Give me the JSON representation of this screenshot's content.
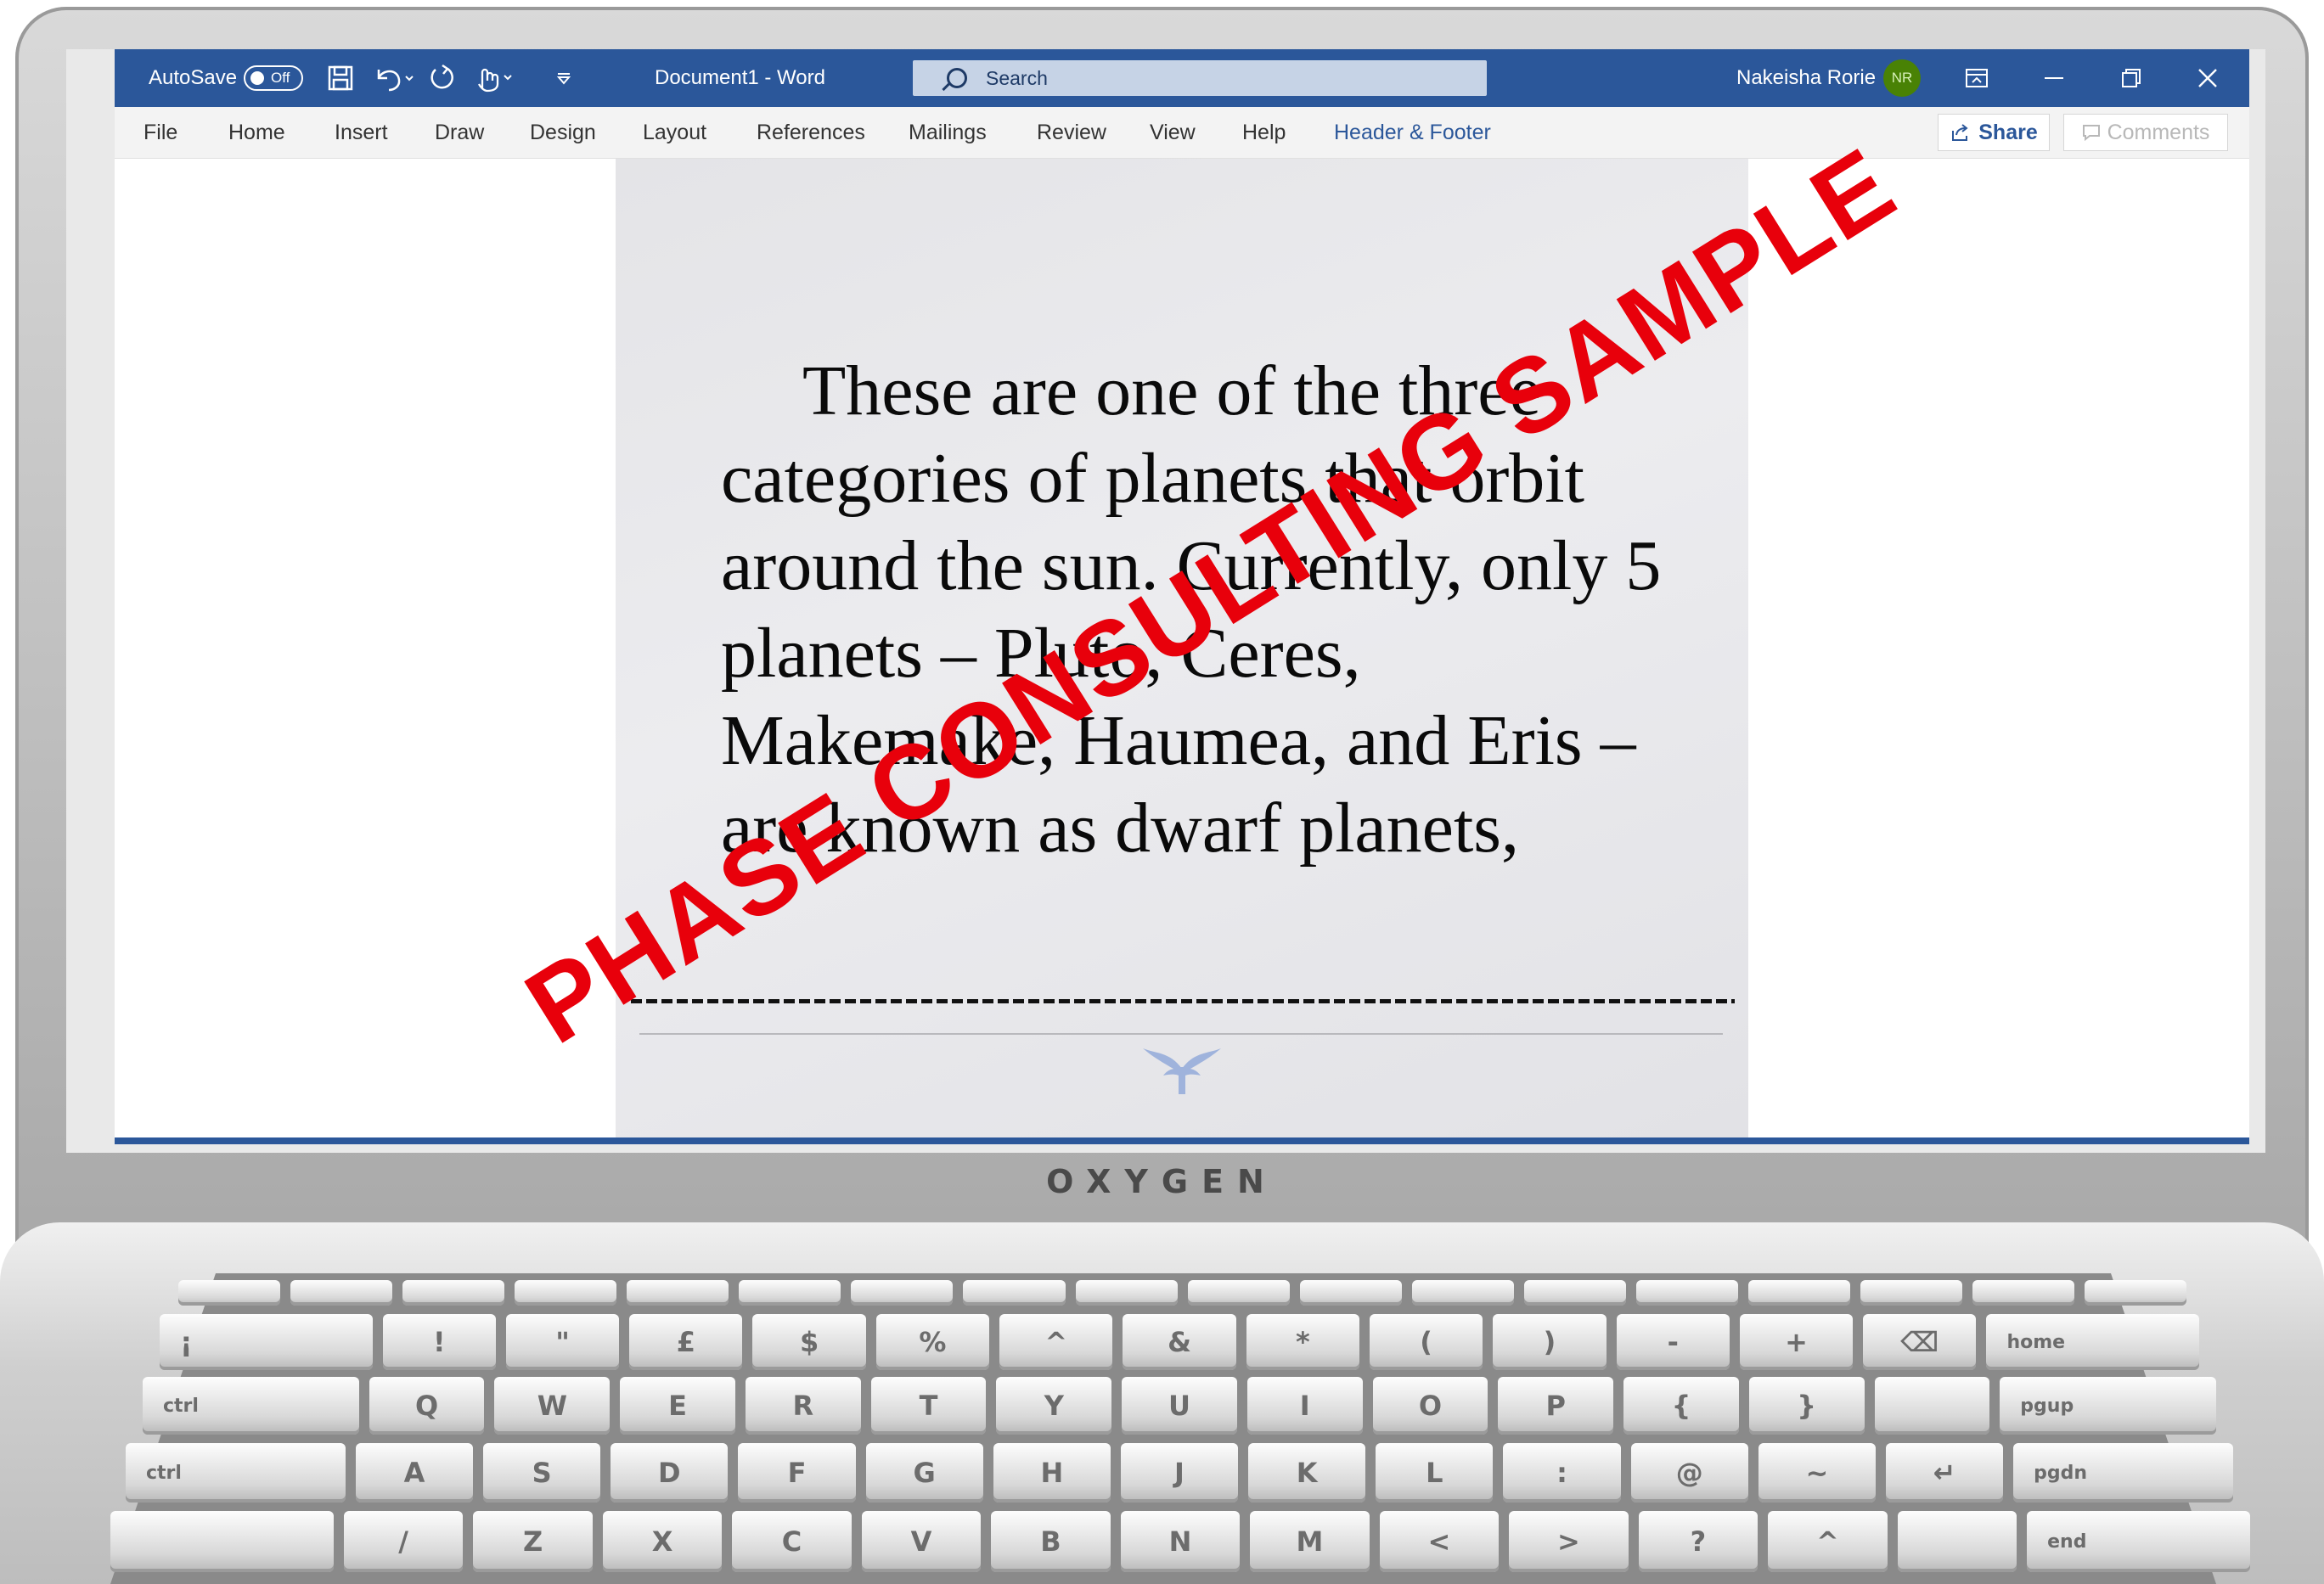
{
  "device": {
    "brand": "OXYGEN"
  },
  "word": {
    "autosave_label": "AutoSave",
    "autosave_state": "Off",
    "doc_title": "Document1  -  Word",
    "search_placeholder": "Search",
    "user_name": "Nakeisha Rorie",
    "user_initials": "NR",
    "accent_color": "#2b579a",
    "tabs": [
      "File",
      "Home",
      "Insert",
      "Draw",
      "Design",
      "Layout",
      "References",
      "Mailings",
      "Review",
      "View",
      "Help",
      "Header & Footer"
    ],
    "share_label": "Share",
    "comments_label": "Comments",
    "icons": [
      "save-icon",
      "undo-icon",
      "redo-icon",
      "touch-mode-icon",
      "customize-qat-icon",
      "ribbon-display-icon",
      "minimize-icon",
      "restore-icon",
      "close-icon"
    ]
  },
  "document": {
    "body_text": "These are one of the three categories of planets that orbit around the sun. Currently, only 5 planets – Pluto, Ceres, Makemake, Haumea, and Eris – are known as dwarf planets,",
    "divider_text": "------------------------------------------------------------------------------------------"
  },
  "watermark": {
    "text": "PHASE CONSULTING SAMPLE",
    "color": "#e8000b"
  },
  "keyboard": {
    "row0": [
      "",
      "",
      "",
      "",
      "",
      "",
      "",
      "",
      "",
      "",
      "",
      "",
      "",
      "",
      "",
      "",
      "",
      ""
    ],
    "row1": [
      "¡",
      "!",
      "\"",
      "£",
      "$",
      "%",
      "^",
      "&",
      "*",
      "(",
      ")",
      "-",
      "+",
      "⌫",
      "home"
    ],
    "row2": [
      "ctrl",
      "Q",
      "W",
      "E",
      "R",
      "T",
      "Y",
      "U",
      "I",
      "O",
      "P",
      "{",
      "}",
      "",
      "pgup"
    ],
    "row3": [
      "ctrl",
      "A",
      "S",
      "D",
      "F",
      "G",
      "H",
      "J",
      "K",
      "L",
      ":",
      "@",
      "~",
      "↵",
      "pgdn"
    ],
    "row4": [
      "",
      "/",
      "Z",
      "X",
      "C",
      "V",
      "B",
      "N",
      "M",
      "<",
      ">",
      "?",
      "^",
      "",
      "end"
    ]
  }
}
